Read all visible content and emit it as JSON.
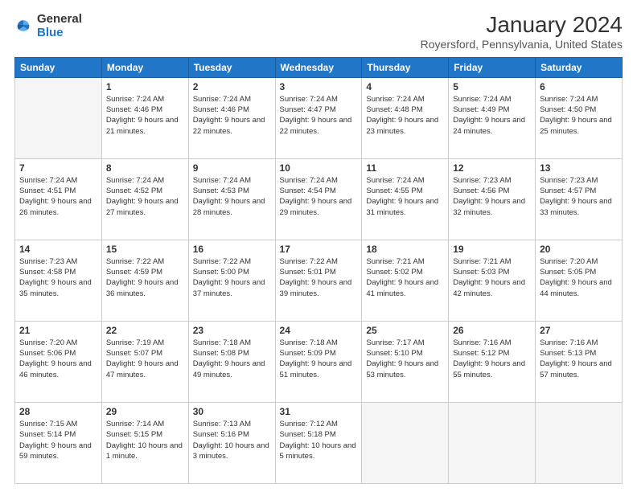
{
  "logo": {
    "general": "General",
    "blue": "Blue"
  },
  "title": "January 2024",
  "subtitle": "Royersford, Pennsylvania, United States",
  "headers": [
    "Sunday",
    "Monday",
    "Tuesday",
    "Wednesday",
    "Thursday",
    "Friday",
    "Saturday"
  ],
  "weeks": [
    [
      {
        "num": "",
        "detail": ""
      },
      {
        "num": "1",
        "detail": "Sunrise: 7:24 AM\nSunset: 4:46 PM\nDaylight: 9 hours\nand 21 minutes."
      },
      {
        "num": "2",
        "detail": "Sunrise: 7:24 AM\nSunset: 4:46 PM\nDaylight: 9 hours\nand 22 minutes."
      },
      {
        "num": "3",
        "detail": "Sunrise: 7:24 AM\nSunset: 4:47 PM\nDaylight: 9 hours\nand 22 minutes."
      },
      {
        "num": "4",
        "detail": "Sunrise: 7:24 AM\nSunset: 4:48 PM\nDaylight: 9 hours\nand 23 minutes."
      },
      {
        "num": "5",
        "detail": "Sunrise: 7:24 AM\nSunset: 4:49 PM\nDaylight: 9 hours\nand 24 minutes."
      },
      {
        "num": "6",
        "detail": "Sunrise: 7:24 AM\nSunset: 4:50 PM\nDaylight: 9 hours\nand 25 minutes."
      }
    ],
    [
      {
        "num": "7",
        "detail": "Sunrise: 7:24 AM\nSunset: 4:51 PM\nDaylight: 9 hours\nand 26 minutes."
      },
      {
        "num": "8",
        "detail": "Sunrise: 7:24 AM\nSunset: 4:52 PM\nDaylight: 9 hours\nand 27 minutes."
      },
      {
        "num": "9",
        "detail": "Sunrise: 7:24 AM\nSunset: 4:53 PM\nDaylight: 9 hours\nand 28 minutes."
      },
      {
        "num": "10",
        "detail": "Sunrise: 7:24 AM\nSunset: 4:54 PM\nDaylight: 9 hours\nand 29 minutes."
      },
      {
        "num": "11",
        "detail": "Sunrise: 7:24 AM\nSunset: 4:55 PM\nDaylight: 9 hours\nand 31 minutes."
      },
      {
        "num": "12",
        "detail": "Sunrise: 7:23 AM\nSunset: 4:56 PM\nDaylight: 9 hours\nand 32 minutes."
      },
      {
        "num": "13",
        "detail": "Sunrise: 7:23 AM\nSunset: 4:57 PM\nDaylight: 9 hours\nand 33 minutes."
      }
    ],
    [
      {
        "num": "14",
        "detail": "Sunrise: 7:23 AM\nSunset: 4:58 PM\nDaylight: 9 hours\nand 35 minutes."
      },
      {
        "num": "15",
        "detail": "Sunrise: 7:22 AM\nSunset: 4:59 PM\nDaylight: 9 hours\nand 36 minutes."
      },
      {
        "num": "16",
        "detail": "Sunrise: 7:22 AM\nSunset: 5:00 PM\nDaylight: 9 hours\nand 37 minutes."
      },
      {
        "num": "17",
        "detail": "Sunrise: 7:22 AM\nSunset: 5:01 PM\nDaylight: 9 hours\nand 39 minutes."
      },
      {
        "num": "18",
        "detail": "Sunrise: 7:21 AM\nSunset: 5:02 PM\nDaylight: 9 hours\nand 41 minutes."
      },
      {
        "num": "19",
        "detail": "Sunrise: 7:21 AM\nSunset: 5:03 PM\nDaylight: 9 hours\nand 42 minutes."
      },
      {
        "num": "20",
        "detail": "Sunrise: 7:20 AM\nSunset: 5:05 PM\nDaylight: 9 hours\nand 44 minutes."
      }
    ],
    [
      {
        "num": "21",
        "detail": "Sunrise: 7:20 AM\nSunset: 5:06 PM\nDaylight: 9 hours\nand 46 minutes."
      },
      {
        "num": "22",
        "detail": "Sunrise: 7:19 AM\nSunset: 5:07 PM\nDaylight: 9 hours\nand 47 minutes."
      },
      {
        "num": "23",
        "detail": "Sunrise: 7:18 AM\nSunset: 5:08 PM\nDaylight: 9 hours\nand 49 minutes."
      },
      {
        "num": "24",
        "detail": "Sunrise: 7:18 AM\nSunset: 5:09 PM\nDaylight: 9 hours\nand 51 minutes."
      },
      {
        "num": "25",
        "detail": "Sunrise: 7:17 AM\nSunset: 5:10 PM\nDaylight: 9 hours\nand 53 minutes."
      },
      {
        "num": "26",
        "detail": "Sunrise: 7:16 AM\nSunset: 5:12 PM\nDaylight: 9 hours\nand 55 minutes."
      },
      {
        "num": "27",
        "detail": "Sunrise: 7:16 AM\nSunset: 5:13 PM\nDaylight: 9 hours\nand 57 minutes."
      }
    ],
    [
      {
        "num": "28",
        "detail": "Sunrise: 7:15 AM\nSunset: 5:14 PM\nDaylight: 9 hours\nand 59 minutes."
      },
      {
        "num": "29",
        "detail": "Sunrise: 7:14 AM\nSunset: 5:15 PM\nDaylight: 10 hours\nand 1 minute."
      },
      {
        "num": "30",
        "detail": "Sunrise: 7:13 AM\nSunset: 5:16 PM\nDaylight: 10 hours\nand 3 minutes."
      },
      {
        "num": "31",
        "detail": "Sunrise: 7:12 AM\nSunset: 5:18 PM\nDaylight: 10 hours\nand 5 minutes."
      },
      {
        "num": "",
        "detail": ""
      },
      {
        "num": "",
        "detail": ""
      },
      {
        "num": "",
        "detail": ""
      }
    ]
  ]
}
